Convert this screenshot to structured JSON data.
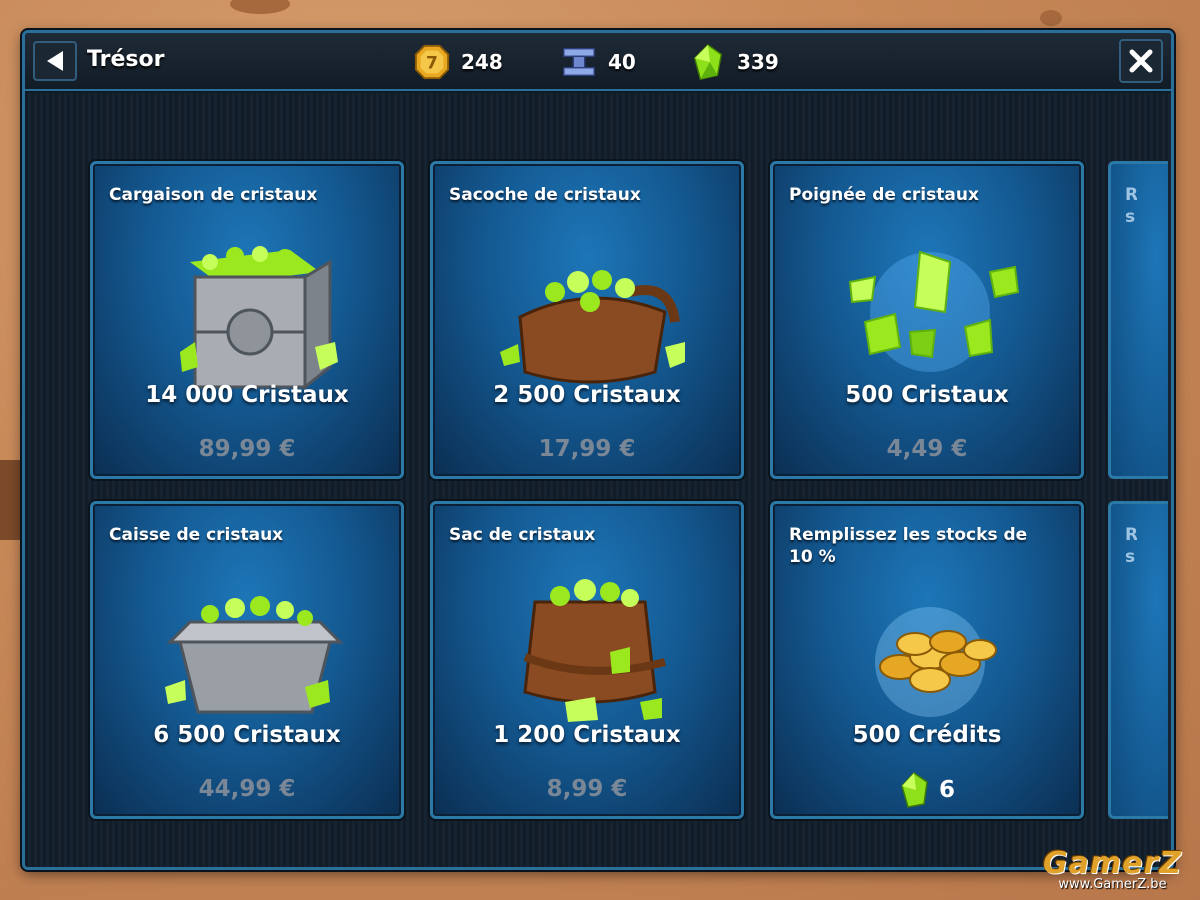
{
  "header": {
    "title": "Trésor",
    "resources": [
      {
        "icon": "credit-coin-icon",
        "value": "248"
      },
      {
        "icon": "alloy-icon",
        "value": "40"
      },
      {
        "icon": "crystal-icon",
        "value": "339"
      }
    ]
  },
  "offers": [
    {
      "title": "Cargaison de cristaux",
      "amount": "14 000 Cristaux",
      "price": "89,99 €",
      "art": "crystal-crate-icon"
    },
    {
      "title": "Sacoche de cristaux",
      "amount": "2 500 Cristaux",
      "price": "17,99 €",
      "art": "crystal-satchel-icon"
    },
    {
      "title": "Poignée de cristaux",
      "amount": "500 Cristaux",
      "price": "4,49 €",
      "art": "crystal-handful-icon"
    },
    {
      "title": "Caisse de cristaux",
      "amount": "6 500 Cristaux",
      "price": "44,99 €",
      "art": "crystal-bin-icon"
    },
    {
      "title": "Sac de cristaux",
      "amount": "1 200 Cristaux",
      "price": "8,99 €",
      "art": "crystal-bag-icon"
    },
    {
      "title": "Remplissez les stocks de 10 %",
      "amount": "500 Crédits",
      "price_gems": "6",
      "art": "coin-pile-icon"
    }
  ],
  "partial_cards": [
    {
      "stub": "R s"
    },
    {
      "stub": "R s"
    }
  ],
  "watermark": {
    "logo": "GamerZ",
    "url": "www.GamerZ.be"
  },
  "colors": {
    "accent": "#2c79a8",
    "card": "#145a93",
    "crystal": "#9be81f",
    "gold": "#e6a824"
  }
}
